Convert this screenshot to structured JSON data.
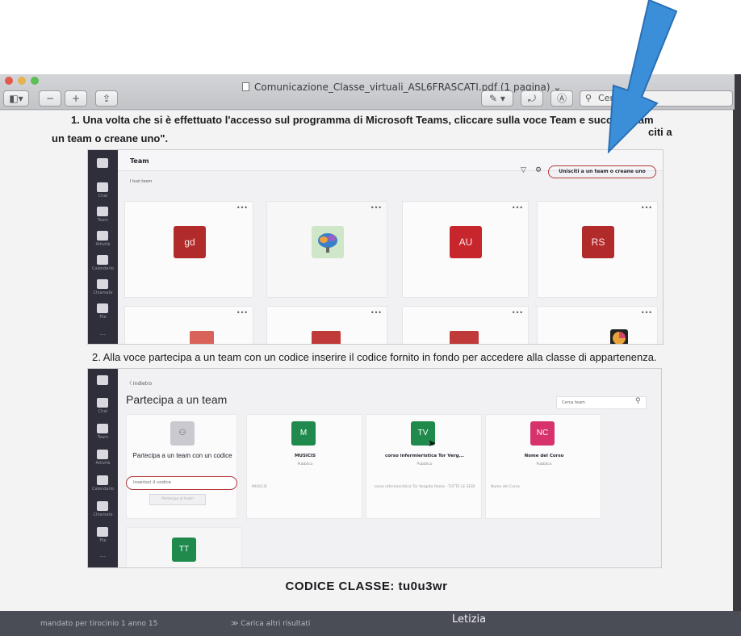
{
  "window": {
    "title": "Comunicazione_Classe_virtuali_ASL6FRASCATI.pdf (1 pagina)",
    "title_chevron": "⌄",
    "search_placeholder": "Cer"
  },
  "toolbar": {
    "sidebar_button": "◧▾",
    "zoom_out": "−",
    "zoom_in": "+",
    "share": "⇪",
    "pen_button": "✎ ▾",
    "rotate_button": "⤾",
    "markup_button": "Ⓐ"
  },
  "document": {
    "step1_line1": "1. Una volta che si è effettuato l'accesso sul programma di Microsoft Teams, cliccare sulla voce Team e successivam",
    "step1_line1_end": "citi a",
    "step1_line2": "un team o creane uno\".",
    "step2": "2. Alla voce partecipa a un team con un codice inserire il codice fornito in fondo per accedere alla classe di appartenenza.",
    "code": "CODICE CLASSE: tu0u3wr"
  },
  "teams_shot1": {
    "header_title": "Team",
    "subheader": "I tuoi team",
    "join_or_create": "Unisciti a un team o creane uno",
    "rail": [
      "Attività",
      "Chat",
      "Team",
      "Attività",
      "Calendario",
      "Chiamate",
      "File",
      "..."
    ],
    "cards": [
      {
        "label": "gd",
        "color": "#b22b2b"
      },
      {
        "label": "",
        "color": "#cfe6c8"
      },
      {
        "label": "AU",
        "color": "#c8262d"
      },
      {
        "label": "RS",
        "color": "#b22b2b"
      }
    ]
  },
  "teams_shot2": {
    "back": "〈 Indietro",
    "title": "Partecipa a un team",
    "search_placeholder": "Cerca team",
    "join_card_title": "Partecipa a un team con un codice",
    "code_placeholder": "Inserisci il codice",
    "join_button": "Partecipa al team",
    "cards": [
      {
        "tile": "M",
        "name": "MUSICIS",
        "visibility": "Pubblico",
        "desc": "MUSICIS",
        "color": "#1f8a4c"
      },
      {
        "tile": "TV",
        "name": "corso infermieristica Tor Verg...",
        "visibility": "Pubblico",
        "desc": "corso infermieristica Tor Vergata Roma - TUTTE LE SEDI",
        "color": "#1f8a4c"
      },
      {
        "tile": "NC",
        "name": "Nome del Corso",
        "visibility": "Pubblico",
        "desc": "Nome del Corso",
        "color": "#d6336c"
      }
    ],
    "extra_tile": "TT"
  },
  "bottom_strip": {
    "left": "mandato per tirocinio 1 anno  15",
    "middle": "≫ Carica altri risultati",
    "right": "Letizia"
  },
  "colors": {
    "arrow": "#3b8fd9",
    "teams_rail": "#2f2f3b",
    "highlight_circle": "#b23a3a"
  }
}
